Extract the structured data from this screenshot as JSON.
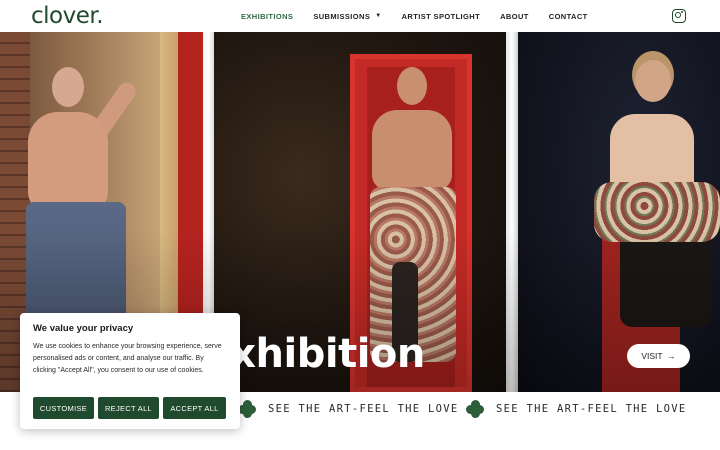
{
  "brand": {
    "logo_text": "clover",
    "logo_dot": ".",
    "accent_color": "#1f4a2e"
  },
  "nav": {
    "items": [
      {
        "label": "EXHIBITIONS",
        "active": true
      },
      {
        "label": "SUBMISSIONS",
        "has_dropdown": true
      },
      {
        "label": "ARTIST SPOTLIGHT"
      },
      {
        "label": "ABOUT"
      },
      {
        "label": "CONTACT"
      }
    ],
    "dropdown_icon": "chevron-down-icon",
    "social_icon": "instagram-icon"
  },
  "hero": {
    "title": "ve” Exhibition",
    "visit_label": "VISIT",
    "visit_icon": "arrow-right-icon"
  },
  "ticker": {
    "text": "SEE THE ART-FEEL THE LOVE",
    "icon": "clover-icon"
  },
  "cookie": {
    "title": "We value your privacy",
    "body": "We use cookies to enhance your browsing experience, serve personalised ads or content, and analyse our traffic. By clicking \"Accept All\", you consent to our use of cookies.",
    "buttons": [
      "CUSTOMISE",
      "REJECT ALL",
      "ACCEPT ALL"
    ]
  }
}
